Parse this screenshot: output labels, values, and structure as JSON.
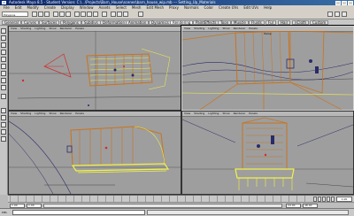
{
  "window": {
    "title": "Autodesk Maya 8.5 - Student Version: C:\\...\\Projects\\Barn_House\\scenes\\barn_house_wip.mb --- Setting_Up_Materials"
  },
  "menubar": {
    "items": [
      "File",
      "Edit",
      "Modify",
      "Create",
      "Display",
      "Window",
      "Assets",
      "Select",
      "Mesh",
      "Edit Mesh",
      "Proxy",
      "Normals",
      "Color",
      "Create UVs",
      "Edit UVs",
      "Help"
    ]
  },
  "statusline": {
    "mode": "Polygons"
  },
  "shelf": {
    "tabs": [
      "General",
      "Curves",
      "Surfaces",
      "Polygons",
      "Subdivs",
      "Deformation",
      "Animation",
      "Dynamics",
      "Rendering",
      "PaintEffects",
      "Toon",
      "Muscle",
      "Fluids",
      "Fur",
      "Hair",
      "nCloth",
      "Custom"
    ],
    "active_tab": "Rendering"
  },
  "viewport_menu": [
    "View",
    "Shading",
    "Lighting",
    "Show",
    "Renderer",
    "Panels"
  ],
  "viewports": [
    {
      "id": "top",
      "label": ""
    },
    {
      "id": "persp",
      "label": "Persp"
    },
    {
      "id": "front",
      "label": ""
    },
    {
      "id": "side",
      "label": ""
    }
  ],
  "colors": {
    "viewport_bg": "#9e9e9e",
    "wire_orange": "#c8741e",
    "wire_yellow": "#f2f24a",
    "wire_dark": "#2a2a6a",
    "camera_red": "#d22a2a"
  },
  "timeslider": {
    "current_frame": "1.00"
  },
  "rangeslider": {
    "start": "1.00",
    "end": "24.00",
    "range_start": "1.00",
    "range_end": "48.00"
  },
  "cmdline": {
    "label": "MEL"
  }
}
